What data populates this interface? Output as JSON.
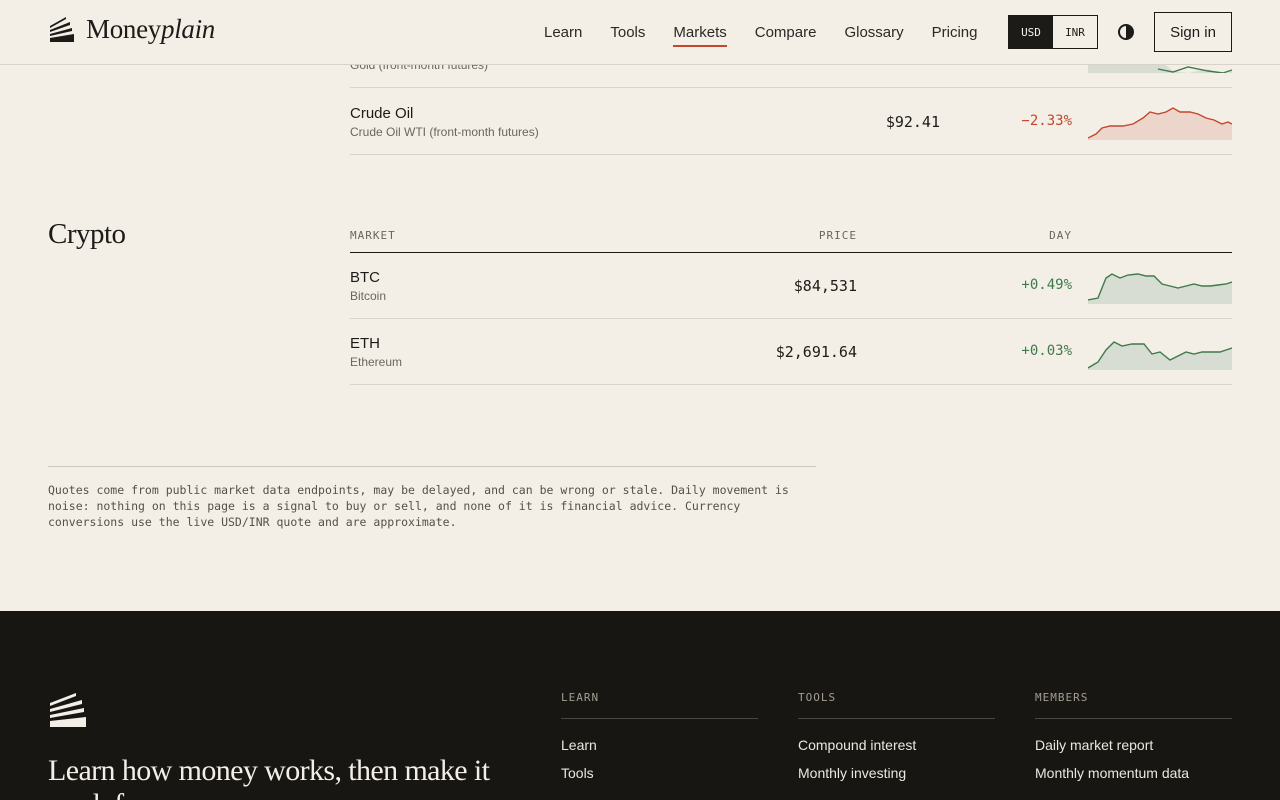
{
  "header": {
    "brand_main": "Money",
    "brand_italic": "plain",
    "nav": [
      "Learn",
      "Tools",
      "Markets",
      "Compare",
      "Glossary",
      "Pricing"
    ],
    "active_nav": "Markets",
    "currency": [
      "USD",
      "INR"
    ],
    "selected_currency": "USD",
    "signin_label": "Sign in"
  },
  "commodities": {
    "rows": [
      {
        "symbol": "",
        "description": "Gold (front-month futures)"
      },
      {
        "symbol": "Crude Oil",
        "description": "Crude Oil WTI (front-month futures)",
        "price": "$92.41",
        "change": "−2.33%",
        "trend": "down"
      }
    ]
  },
  "crypto": {
    "title": "Crypto",
    "headers": {
      "market": "MARKET",
      "price": "PRICE",
      "day": "DAY"
    },
    "rows": [
      {
        "symbol": "BTC",
        "description": "Bitcoin",
        "price": "$84,531",
        "change": "+0.49%",
        "trend": "up"
      },
      {
        "symbol": "ETH",
        "description": "Ethereum",
        "price": "$2,691.64",
        "change": "+0.03%",
        "trend": "up"
      }
    ]
  },
  "disclaimer": "Quotes come from public market data endpoints, may be delayed, and can be wrong or stale. Daily movement is noise: nothing on this page is a signal to buy or sell, and none of it is financial advice. Currency conversions use the live USD/INR quote and are approximate.",
  "footer": {
    "tagline": "Learn how money works, then make it work for you.",
    "columns": [
      {
        "heading": "LEARN",
        "links": [
          "Learn",
          "Tools"
        ]
      },
      {
        "heading": "TOOLS",
        "links": [
          "Compound interest",
          "Monthly investing"
        ]
      },
      {
        "heading": "MEMBERS",
        "links": [
          "Daily market report",
          "Monthly momentum data"
        ]
      }
    ]
  },
  "colors": {
    "accent": "#c5462d",
    "positive": "#3f7a4a",
    "background": "#f3efe7",
    "footer": "#171612"
  }
}
